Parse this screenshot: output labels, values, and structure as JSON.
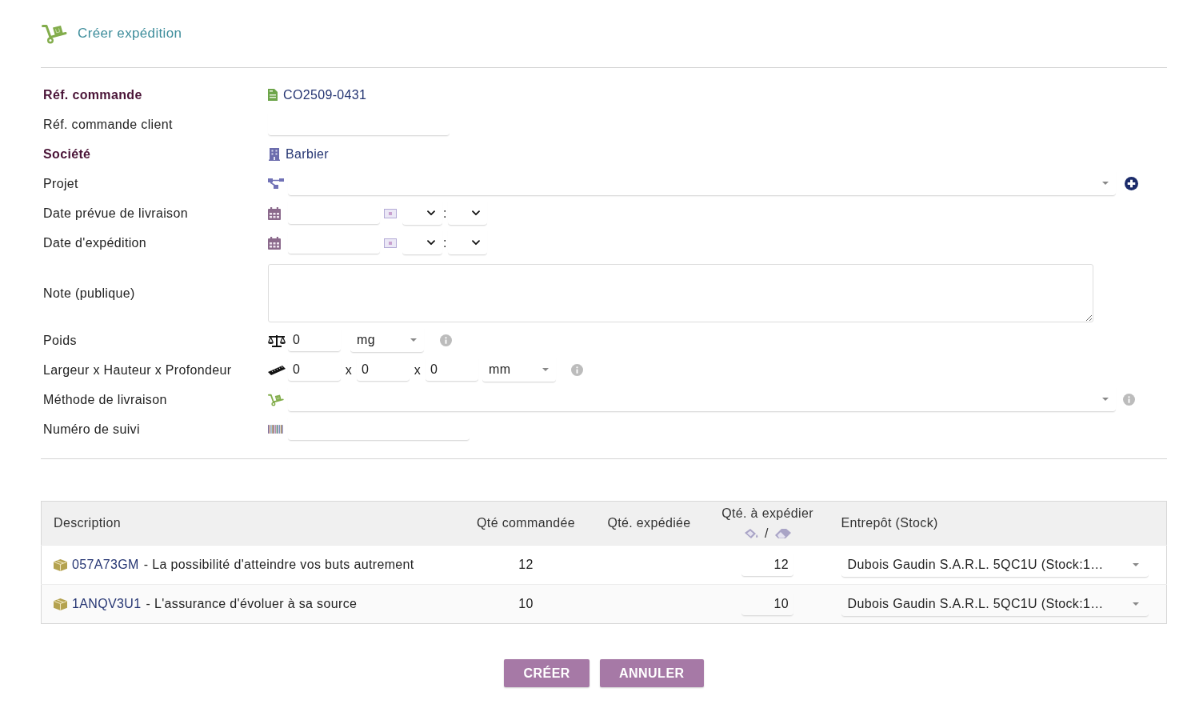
{
  "header": {
    "title": "Créer expédition"
  },
  "fields": [
    {
      "kind": "order",
      "label": "Réf. commande",
      "emphasized": true,
      "value": "CO2509-0431"
    },
    {
      "kind": "text",
      "label": "Réf. commande client",
      "emphasized": false
    },
    {
      "kind": "company",
      "label": "Société",
      "emphasized": true,
      "value": "Barbier"
    },
    {
      "kind": "project",
      "label": "Projet",
      "emphasized": false
    },
    {
      "kind": "date",
      "label": "Date prévue de livraison",
      "emphasized": false,
      "time_separator": ":"
    },
    {
      "kind": "date",
      "label": "Date d'expédition",
      "emphasized": false,
      "time_separator": ":"
    },
    {
      "kind": "note",
      "label": "Note (publique)",
      "emphasized": false
    },
    {
      "kind": "weight",
      "label": "Poids",
      "emphasized": false,
      "value": "0",
      "unit": "mg"
    },
    {
      "kind": "size",
      "label": "Largeur x Hauteur x Profondeur",
      "emphasized": false,
      "values": [
        "0",
        "0",
        "0"
      ],
      "separators": [
        "x",
        "x"
      ],
      "unit": "mm"
    },
    {
      "kind": "method",
      "label": "Méthode de livraison",
      "emphasized": false
    },
    {
      "kind": "tracking",
      "label": "Numéro de suivi",
      "emphasized": false
    }
  ],
  "lines": {
    "columns": [
      {
        "label": "Description"
      },
      {
        "label": "Qté commandée"
      },
      {
        "label": "Qté. expédiée"
      },
      {
        "label": "Qté. à expédier",
        "separator": "/"
      },
      {
        "label": "Entrepôt (Stock)"
      }
    ],
    "rows": [
      {
        "ref": "057A73GM",
        "label": "- La possibilité d'atteindre vos buts autrement",
        "ordered": "12",
        "to_ship": "12",
        "warehouse": "Dubois Gaudin S.A.R.L. 5QC1U (Stock:1…"
      },
      {
        "ref": "1ANQV3U1",
        "label": "- L'assurance d'évoluer à sa source",
        "ordered": "10",
        "to_ship": "10",
        "warehouse": "Dubois Gaudin S.A.R.L. 5QC1U (Stock:1…"
      }
    ]
  },
  "buttons": [
    "CRÉER",
    "ANNULER"
  ]
}
